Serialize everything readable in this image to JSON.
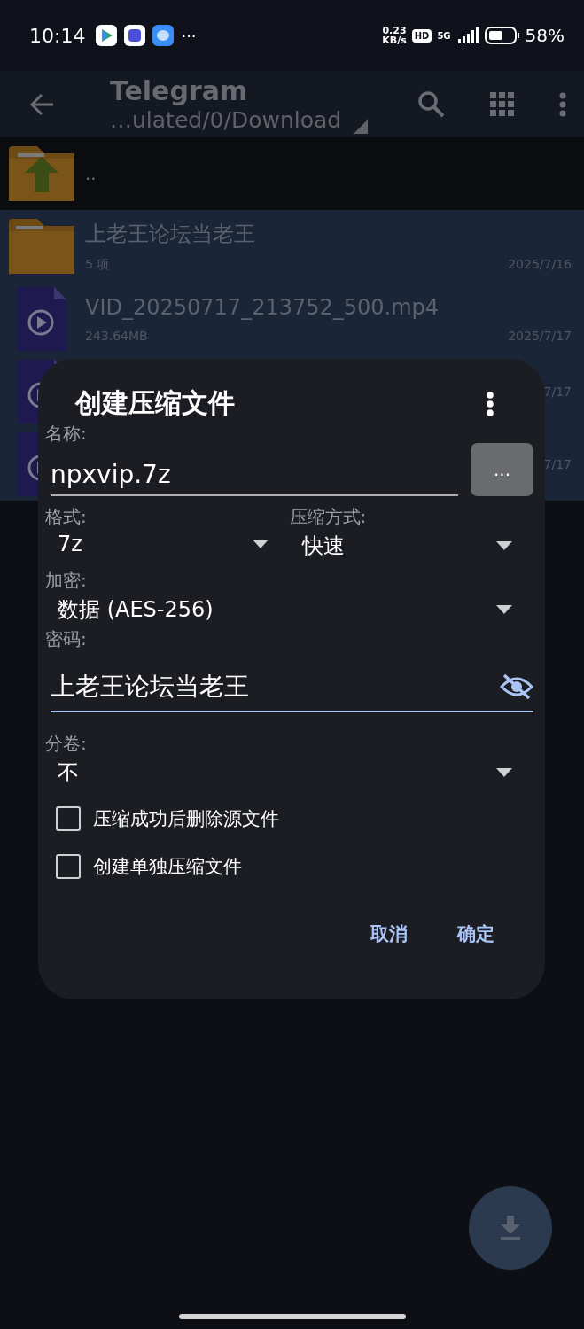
{
  "status_bar": {
    "time": "10:14",
    "more": "···",
    "net_speed": "0.23",
    "net_unit": "KB/s",
    "hd": "HD",
    "network": "5G",
    "battery": "58%"
  },
  "app_bar": {
    "title": "Telegram",
    "path": "…ulated/0/Download"
  },
  "files": [
    {
      "kind": "parent",
      "name": "..",
      "selected": false
    },
    {
      "kind": "folder",
      "name": "上老王论坛当老王",
      "meta": "5 项",
      "date": "2025/7/16",
      "selected": true
    },
    {
      "kind": "video",
      "name": "VID_20250717_213752_500.mp4",
      "meta": "243.64MB",
      "date": "2025/7/17",
      "selected": true
    },
    {
      "kind": "video",
      "date": "7/17",
      "selected": true
    },
    {
      "kind": "video",
      "date": "7/17",
      "selected": true
    }
  ],
  "dialog": {
    "title": "创建压缩文件",
    "name": {
      "label": "名称:",
      "value": "npxvip.7z",
      "button": "..."
    },
    "format": {
      "label": "格式:",
      "value": "7z"
    },
    "method": {
      "label": "压缩方式:",
      "value": "快速"
    },
    "encryption": {
      "label": "加密:",
      "value": "数据 (AES-256)"
    },
    "password": {
      "label": "密码:",
      "value": "上老王论坛当老王",
      "focused": true
    },
    "volume": {
      "label": "分卷:",
      "value": "不"
    },
    "options": [
      {
        "label": "压缩成功后删除源文件",
        "checked": false
      },
      {
        "label": "创建单独压缩文件",
        "checked": false
      }
    ],
    "buttons": [
      "取消",
      "确定"
    ]
  }
}
